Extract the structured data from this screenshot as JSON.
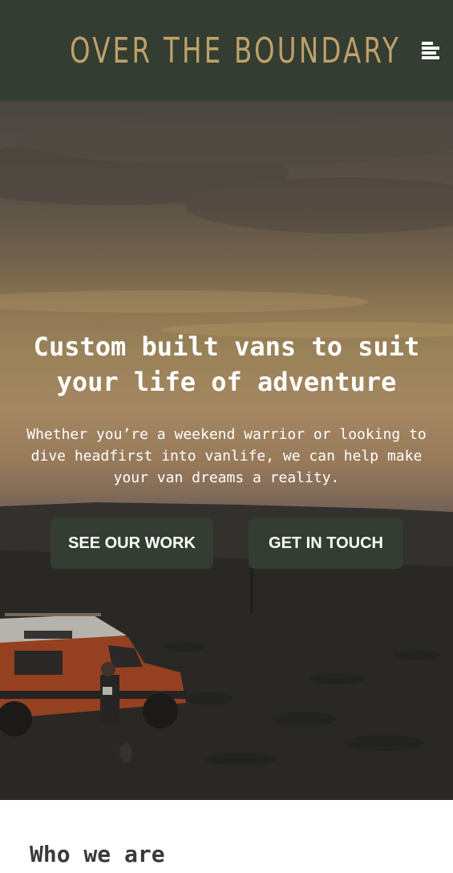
{
  "header": {
    "brand": "OVER THE BOUNDARY",
    "menu_icon": "hamburger-menu-icon",
    "background_color": "#333d31",
    "brand_color": "#bfa06a"
  },
  "hero": {
    "title": "Custom built vans to suit your life of adventure",
    "subtitle": "Whether you’re a weekend warrior or looking to dive headfirst into vanlife, we can help make your van dreams a reality.",
    "buttons": {
      "primary": "SEE OUR WORK",
      "secondary": "GET IN TOUCH"
    },
    "button_color": "#333d31"
  },
  "about": {
    "heading": "Who we are"
  }
}
